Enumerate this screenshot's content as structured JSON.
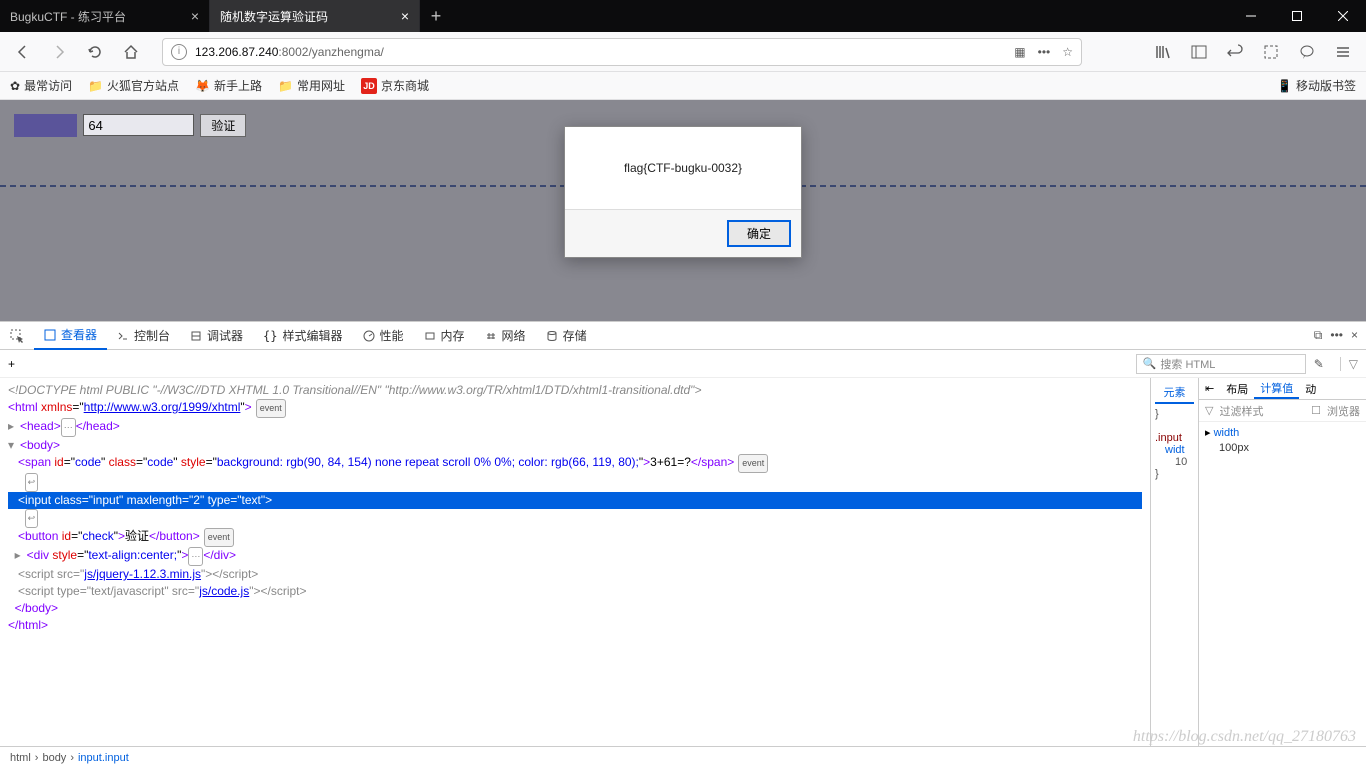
{
  "titlebar": {
    "tabs": [
      {
        "title": "BugkuCTF - 练习平台"
      },
      {
        "title": "随机数字运算验证码"
      }
    ],
    "new_tab": "+"
  },
  "navbar": {
    "url_host": "123.206.87.240",
    "url_port": ":8002",
    "url_path": "/yanzhengma/"
  },
  "bookmarks": {
    "frequent": "最常访问",
    "firefox_official": "火狐官方站点",
    "newbie": "新手上路",
    "common": "常用网址",
    "jd": "京东商城",
    "mobile": "移动版书签"
  },
  "page": {
    "code_text": "3+61=?",
    "input_value": "64",
    "verify_label": "验证"
  },
  "alert": {
    "message": "flag{CTF-bugku-0032}",
    "ok": "确定"
  },
  "devtools": {
    "tabs": {
      "inspector": "查看器",
      "console": "控制台",
      "debugger": "调试器",
      "style": "样式编辑器",
      "perf": "性能",
      "memory": "内存",
      "network": "网络",
      "storage": "存储"
    },
    "search_placeholder": "搜索 HTML",
    "plus": "+",
    "html": {
      "doctype": "<!DOCTYPE html PUBLIC \"-//W3C//DTD XHTML 1.0 Transitional//EN\" \"http://www.w3.org/TR/xhtml1/DTD/xhtml1-transitional.dtd\">",
      "xmlns": "http://www.w3.org/1999/xhtml",
      "span_style": "background: rgb(90, 84, 154) none repeat scroll 0% 0%; color: rgb(66, 119, 80);",
      "span_text": "3+61=?",
      "input_attrs": "class=\"input\" maxlength=\"2\" type=\"text\"",
      "button_text": "验证",
      "div_style": "text-align:center;",
      "jquery_src": "js/jquery-1.12.3.min.js",
      "code_src": "js/code.js",
      "event": "event"
    },
    "side1": {
      "elements": "元素",
      "brace": "}",
      "sel": ".input",
      "width_l": "widt",
      "width_v": "10",
      "brace2": "}"
    },
    "side2": {
      "layout": "布局",
      "computed": "计算值",
      "changes": "动",
      "filter": "过滤样式",
      "browser": "浏览器",
      "prop1": "width",
      "val1": "100px"
    },
    "crumbs": {
      "html": "html",
      "body": "body",
      "input": "input.input"
    }
  },
  "watermark": "https://blog.csdn.net/qq_27180763"
}
